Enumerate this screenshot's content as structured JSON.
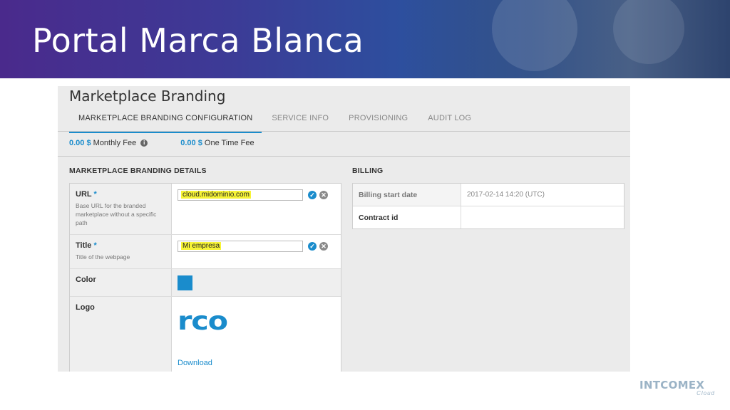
{
  "banner": {
    "title": "Portal Marca Blanca"
  },
  "panel": {
    "title": "Marketplace Branding",
    "tabs": [
      {
        "label": "MARKETPLACE BRANDING CONFIGURATION",
        "active": true
      },
      {
        "label": "SERVICE INFO",
        "active": false
      },
      {
        "label": "PROVISIONING",
        "active": false
      },
      {
        "label": "AUDIT LOG",
        "active": false
      }
    ],
    "fees": {
      "monthly": {
        "amount": "0.00 $",
        "label": "Monthly Fee"
      },
      "one_time": {
        "amount": "0.00 $",
        "label": "One Time Fee"
      }
    }
  },
  "details": {
    "title": "MARKETPLACE BRANDING DETAILS",
    "url": {
      "label": "URL",
      "required_mark": "*",
      "help": "Base URL for the branded marketplace without a specific path",
      "value": "cloud.midominio.com"
    },
    "title_field": {
      "label": "Title",
      "required_mark": "*",
      "help": "Title of the webpage",
      "value": "Mi empresa"
    },
    "color": {
      "label": "Color",
      "value": "#1a8ccc"
    },
    "logo": {
      "label": "Logo",
      "image_text": "rco",
      "download_label": "Download"
    }
  },
  "billing": {
    "title": "BILLING",
    "rows": [
      {
        "label": "Billing start date",
        "value": "2017-02-14 14:20 (UTC)"
      },
      {
        "label": "Contract id",
        "value": ""
      }
    ]
  },
  "footer": {
    "brand": "INTCOMEX",
    "sub": "Cloud"
  },
  "icons": {
    "info": "info-icon",
    "confirm": "check-icon",
    "cancel": "close-icon"
  },
  "colors": {
    "accent": "#1a8ccc",
    "highlight": "#f7f436",
    "banner_start": "#4a2a8c",
    "banner_end": "#27406e"
  }
}
